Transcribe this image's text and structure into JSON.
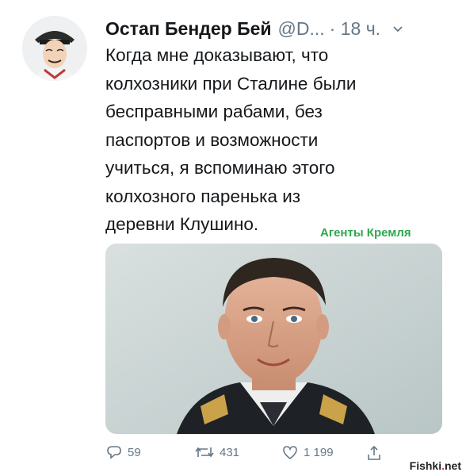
{
  "tweet": {
    "author_name": "Остап Бендер Бей",
    "author_handle": "@D...",
    "time": "· 18 ч.",
    "text_lines": [
      "Когда мне доказывают, что",
      "колхозники при Сталине были",
      "бесправными рабами, без",
      "паспортов и возможности",
      "учиться, я вспоминаю этого",
      "колхозного паренька из",
      "деревни Клушино."
    ],
    "watermark": "Агенты Кремля",
    "actions": {
      "replies": "59",
      "retweets": "431",
      "likes": "1 199"
    }
  },
  "site_watermark": {
    "prefix": "Fishki",
    "dot": ".",
    "suffix": "net"
  },
  "icons": {
    "reply": "reply-icon",
    "retweet": "retweet-icon",
    "like": "heart-icon",
    "share": "share-icon",
    "caret": "chevron-down-icon"
  },
  "colors": {
    "text": "#14171a",
    "muted": "#657786",
    "watermark_green": "#2fa84f"
  }
}
